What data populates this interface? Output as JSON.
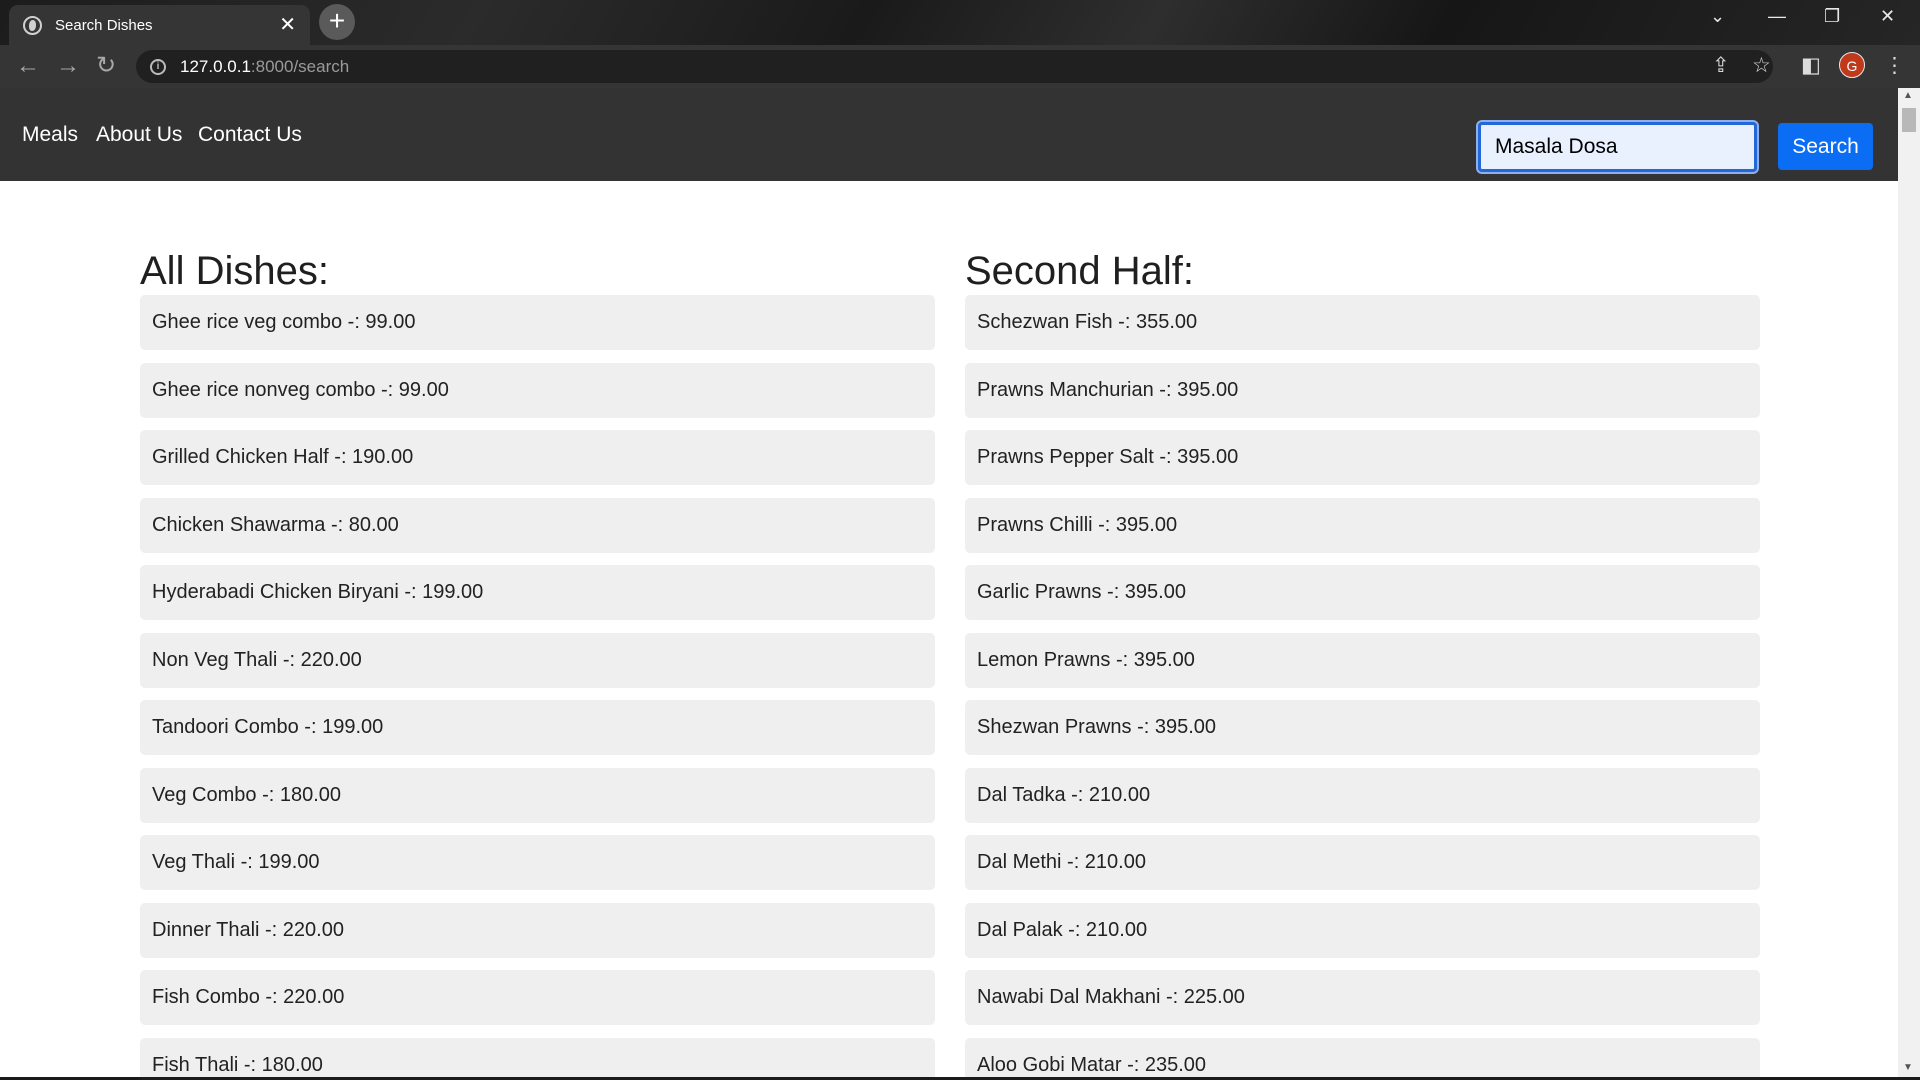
{
  "browser": {
    "tab_title": "Search Dishes",
    "tab_close": "✕",
    "new_tab": "+",
    "url_host": "127.0.0.1",
    "url_path": ":8000/search",
    "profile_initial": "G"
  },
  "navbar": {
    "links": [
      "Meals",
      "About Us",
      "Contact Us"
    ],
    "search_value": "Masala Dosa",
    "search_button": "Search"
  },
  "left": {
    "heading": "All Dishes:",
    "dishes": [
      "Ghee rice veg combo -: 99.00",
      "Ghee rice nonveg combo -: 99.00",
      "Grilled Chicken Half -: 190.00",
      "Chicken Shawarma -: 80.00",
      "Hyderabadi Chicken Biryani -: 199.00",
      "Non Veg Thali -: 220.00",
      "Tandoori Combo -: 199.00",
      "Veg Combo -: 180.00",
      "Veg Thali -: 199.00",
      "Dinner Thali -: 220.00",
      "Fish Combo -: 220.00",
      "Fish Thali -: 180.00"
    ]
  },
  "right": {
    "heading": "Second Half:",
    "dishes": [
      "Schezwan Fish -: 355.00",
      "Prawns Manchurian -: 395.00",
      "Prawns Pepper Salt -: 395.00",
      "Prawns Chilli -: 395.00",
      "Garlic Prawns -: 395.00",
      "Lemon Prawns -: 395.00",
      "Shezwan Prawns -: 395.00",
      "Dal Tadka -: 210.00",
      "Dal Methi -: 210.00",
      "Dal Palak -: 210.00",
      "Nawabi Dal Makhani -: 225.00",
      "Aloo Gobi Matar -: 235.00"
    ]
  },
  "colors": {
    "navbar_bg": "#333333",
    "search_button_bg": "#0b6cf4",
    "dish_bg": "#efefef"
  }
}
